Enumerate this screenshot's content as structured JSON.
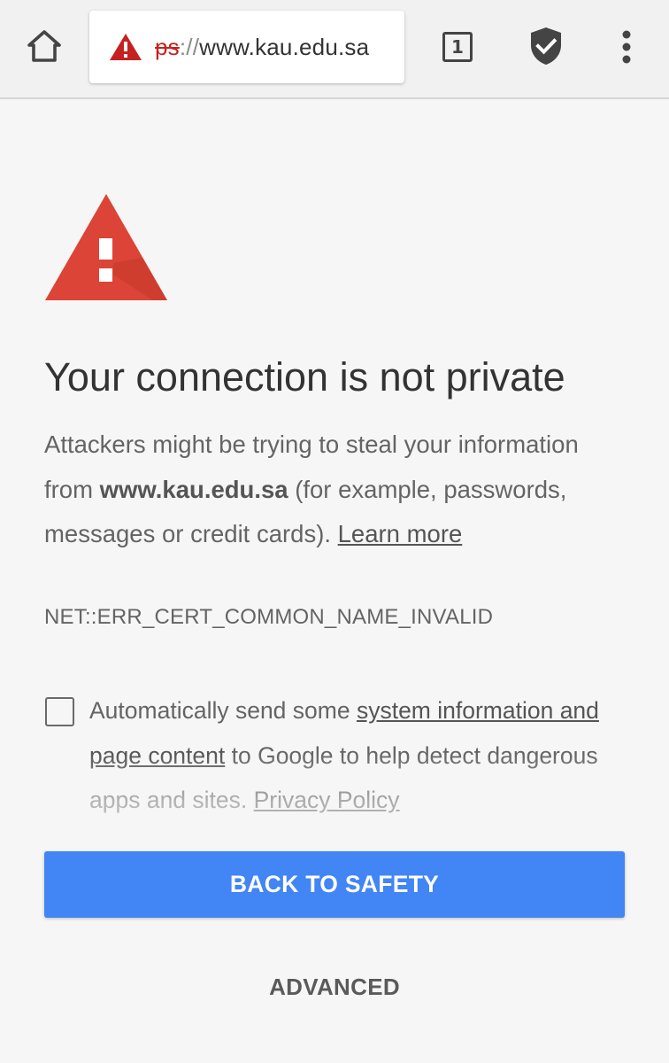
{
  "toolbar": {
    "url_scheme": "ps",
    "url_separator": "://",
    "url_host": "www.kau.edu.sa",
    "tab_count": "1",
    "icons": [
      "home-icon",
      "warning-icon",
      "tabs-icon",
      "shield-check-icon",
      "more-vert-icon"
    ]
  },
  "interstitial": {
    "heading": "Your connection is not private",
    "body_part1": "Attackers might be trying to steal your information from ",
    "body_domain": "www.kau.edu.sa",
    "body_part2": " (for example, passwords, messages or credit cards). ",
    "learn_more_label": "Learn more",
    "error_code": "NET::ERR_CERT_COMMON_NAME_INVALID",
    "optin_part1": "Automatically send some ",
    "optin_link": "system information and page content",
    "optin_part2": " to Google to help detect dangerous apps and sites. ",
    "privacy_policy_label": "Privacy Policy",
    "optin_checked": false,
    "primary_button_label": "BACK TO SAFETY",
    "advanced_button_label": "ADVANCED"
  },
  "colors": {
    "warning_red": "#db4437",
    "primary_blue": "#4285f4",
    "insecure_scheme_red": "#c5221f",
    "background": "#f6f6f6"
  }
}
